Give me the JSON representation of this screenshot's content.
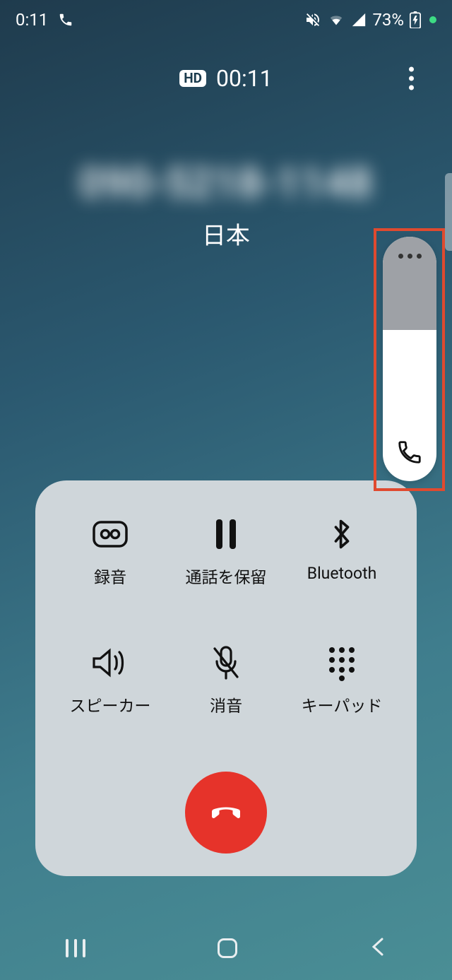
{
  "status": {
    "time": "0:11",
    "battery": "73%"
  },
  "call": {
    "duration": "00:11",
    "hd": "HD",
    "number": "090-5218-1148",
    "region": "日本"
  },
  "actions": {
    "record": "録音",
    "hold": "通話を保留",
    "bluetooth": "Bluetooth",
    "speaker": "スピーカー",
    "mute": "消音",
    "keypad": "キーパッド"
  }
}
